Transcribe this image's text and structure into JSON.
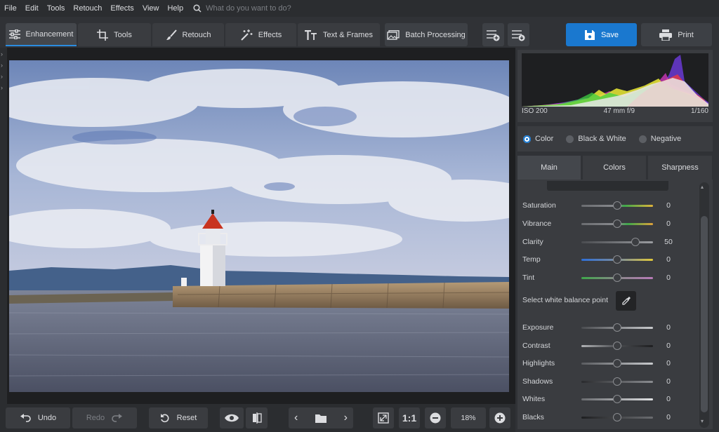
{
  "menu": {
    "items": [
      "File",
      "Edit",
      "Tools",
      "Retouch",
      "Effects",
      "View",
      "Help"
    ],
    "search_placeholder": "What do you want to do?"
  },
  "toolbar": {
    "tabs": [
      {
        "label": "Enhancement",
        "icon": "sliders-icon",
        "active": true
      },
      {
        "label": "Tools",
        "icon": "crop-icon",
        "active": false
      },
      {
        "label": "Retouch",
        "icon": "brush-icon",
        "active": false
      },
      {
        "label": "Effects",
        "icon": "magic-wand-icon",
        "active": false
      },
      {
        "label": "Text & Frames",
        "icon": "text-icon",
        "active": false
      }
    ],
    "batch_label": "Batch Processing",
    "save_label": "Save",
    "print_label": "Print"
  },
  "histogram": {
    "iso": "ISO 200",
    "lens": "47 mm f/9",
    "shutter": "1/160"
  },
  "color_mode": {
    "options": [
      "Color",
      "Black & White",
      "Negative"
    ],
    "selected": "Color"
  },
  "panel_tabs": {
    "tabs": [
      "Main",
      "Colors",
      "Sharpness"
    ],
    "active": "Main"
  },
  "sliders_top": [
    {
      "label": "Saturation",
      "value": "0",
      "level": 0.5
    },
    {
      "label": "Vibrance",
      "value": "0",
      "level": 0.5
    },
    {
      "label": "Clarity",
      "value": "50",
      "level": 0.75
    },
    {
      "label": "Temp",
      "value": "0",
      "level": 0.5
    },
    {
      "label": "Tint",
      "value": "0",
      "level": 0.5
    }
  ],
  "white_balance_label": "Select white balance point",
  "sliders_bottom": [
    {
      "label": "Exposure",
      "value": "0",
      "level": 0.5
    },
    {
      "label": "Contrast",
      "value": "0",
      "level": 0.5
    },
    {
      "label": "Highlights",
      "value": "0",
      "level": 0.5
    },
    {
      "label": "Shadows",
      "value": "0",
      "level": 0.5
    },
    {
      "label": "Whites",
      "value": "0",
      "level": 0.5
    },
    {
      "label": "Blacks",
      "value": "0",
      "level": 0.5
    }
  ],
  "bottom": {
    "undo_label": "Undo",
    "redo_label": "Redo",
    "reset_label": "Reset",
    "one_to_one": "1:1",
    "zoom": "18%"
  },
  "colors": {
    "accent": "#1a78cf",
    "panel": "#303236",
    "background": "#2b2d30"
  }
}
